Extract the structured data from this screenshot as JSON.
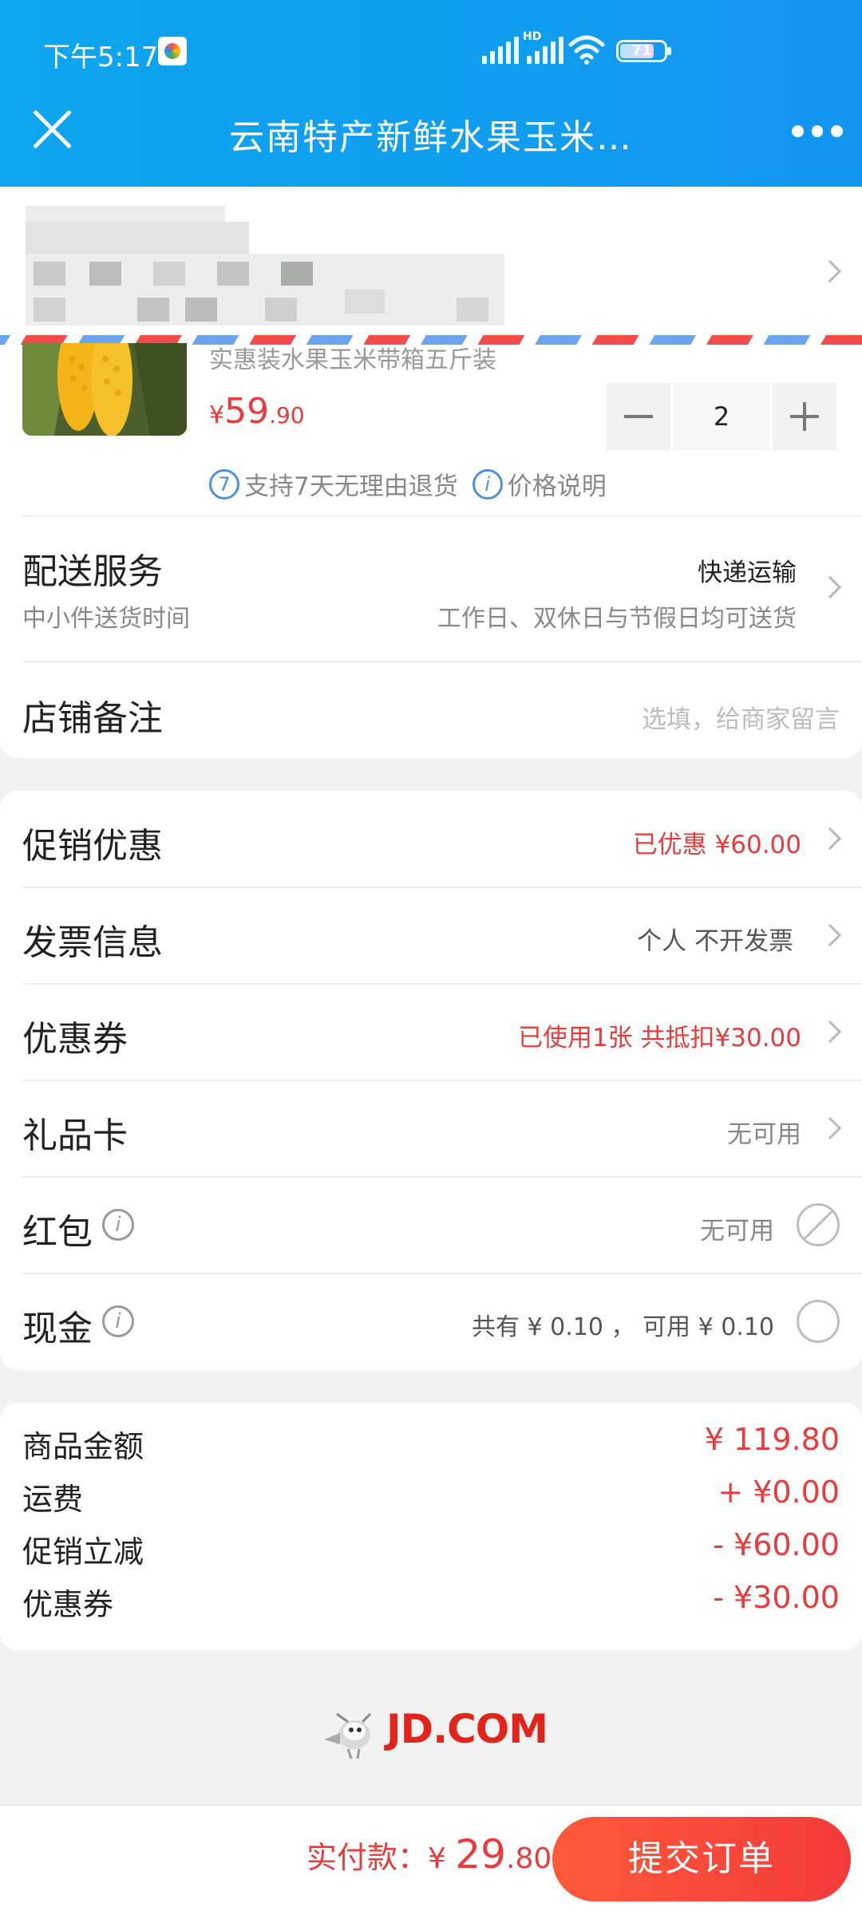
{
  "status_bar": {
    "time": "下午5:17",
    "hd_label": "HD",
    "battery": "71"
  },
  "header": {
    "title": "云南特产新鲜水果玉米…"
  },
  "product": {
    "name": "实惠装水果玉米带箱五斤装",
    "price_currency": "¥",
    "price_main": "59",
    "price_decimal": ".90",
    "quantity": "2",
    "support_icon_text": "7",
    "support_text": "支持7天无理由退货",
    "price_info_icon_text": "i",
    "price_info_text": "价格说明"
  },
  "delivery": {
    "label": "配送服务",
    "method": "快递运输",
    "sub_label": "中小件送货时间",
    "sub_value": "工作日、双休日与节假日均可送货"
  },
  "remark": {
    "label": "店铺备注",
    "placeholder": "选填，给商家留言"
  },
  "options": {
    "promotion": {
      "label": "促销优惠",
      "value": "已优惠 ¥60.00"
    },
    "invoice": {
      "label": "发票信息",
      "value": "个人 不开发票"
    },
    "coupon": {
      "label": "优惠券",
      "value": "已使用1张 共抵扣¥30.00"
    },
    "giftcard": {
      "label": "礼品卡",
      "value": "无可用"
    },
    "redpacket": {
      "label": "红包",
      "info_icon_text": "i",
      "value": "无可用"
    },
    "cash": {
      "label": "现金",
      "info_icon_text": "i",
      "value": "共有 ¥ 0.10 ， 可用 ¥ 0.10"
    }
  },
  "summary": [
    {
      "label": "商品金额",
      "value": "¥ 119.80"
    },
    {
      "label": "运费",
      "value": "+ ¥0.00"
    },
    {
      "label": "促销立减",
      "value": "- ¥60.00"
    },
    {
      "label": "优惠券",
      "value": "- ¥30.00"
    }
  ],
  "footer_logo": "JD.COM",
  "bottom_bar": {
    "pay_label": "实付款：",
    "pay_currency": "¥ ",
    "pay_main": "29",
    "pay_decimal": ".80",
    "submit_label": "提交订单"
  },
  "colors": {
    "header_blue": "#1296f0",
    "accent_red": "#e93b3b",
    "jd_red": "#e1251b"
  }
}
